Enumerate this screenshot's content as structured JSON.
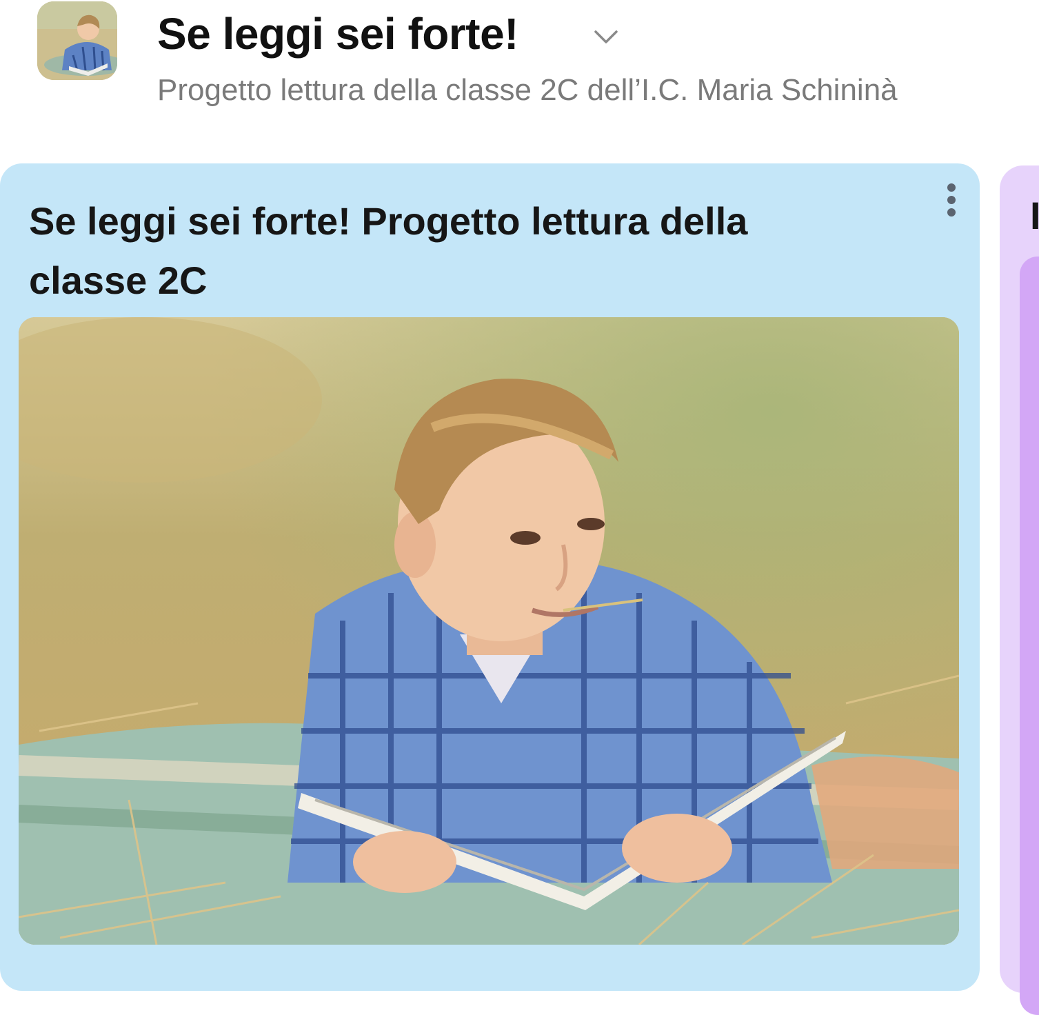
{
  "header": {
    "title": "Se leggi sei forte!",
    "subtitle": "Progetto lettura della classe 2C dell’I.C. Maria Schininà",
    "avatar_icon": "boy-reading-thumbnail",
    "chevron_icon": "chevron-down-icon"
  },
  "section": {
    "title": "Se leggi sei forte! Progetto lettura della classe 2C",
    "menu_icon": "more-vertical-icon",
    "image_icon": "boy-reading-book-in-field",
    "background_color": "#c4e6f8"
  },
  "next_section": {
    "title_fragment": "I",
    "background_color": "#e7d3fb"
  }
}
